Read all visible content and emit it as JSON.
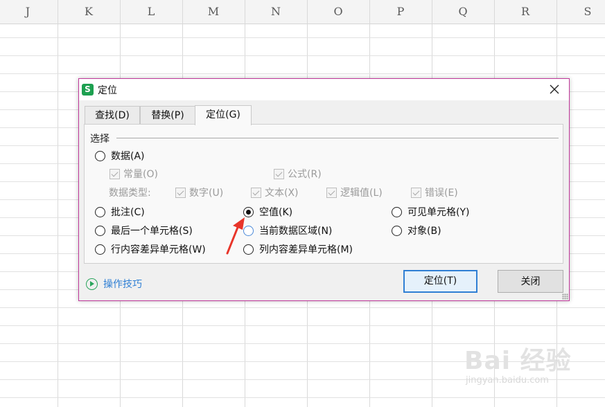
{
  "sheet": {
    "columns": [
      "J",
      "K",
      "L",
      "M",
      "N",
      "O",
      "P",
      "Q",
      "R",
      "S"
    ]
  },
  "dialog": {
    "title": "定位",
    "app_icon": "S",
    "tabs": [
      {
        "label": "查找(D)",
        "active": false
      },
      {
        "label": "替换(P)",
        "active": false
      },
      {
        "label": "定位(G)",
        "active": true
      }
    ],
    "group_label": "选择",
    "options": {
      "data": {
        "label": "数据(A)",
        "checked": false
      },
      "comments": {
        "label": "批注(C)",
        "checked": false
      },
      "blanks": {
        "label": "空值(K)",
        "checked": true
      },
      "visible_cells": {
        "label": "可见单元格(Y)",
        "checked": false
      },
      "last_cell": {
        "label": "最后一个单元格(S)",
        "checked": false
      },
      "current_region": {
        "label": "当前数据区域(N)",
        "checked": false
      },
      "objects": {
        "label": "对象(B)",
        "checked": false
      },
      "row_differences": {
        "label": "行内容差异单元格(W)",
        "checked": false
      },
      "col_differences": {
        "label": "列内容差异单元格(M)",
        "checked": false
      }
    },
    "sub_options": {
      "constants": "常量(O)",
      "formulas": "公式(R)",
      "data_type_label": "数据类型:",
      "numbers": "数字(U)",
      "text": "文本(X)",
      "logicals": "逻辑值(L)",
      "errors": "错误(E)"
    },
    "tips_link": "操作技巧",
    "buttons": {
      "goto": "定位(T)",
      "close": "关闭"
    },
    "colors": {
      "border": "#c0389a",
      "accent": "#2f7fd4",
      "app_icon": "#1da050",
      "arrow": "#e8352a"
    }
  },
  "watermark": {
    "main": "Bai 经验",
    "sub": "jingyan.baidu.com"
  }
}
